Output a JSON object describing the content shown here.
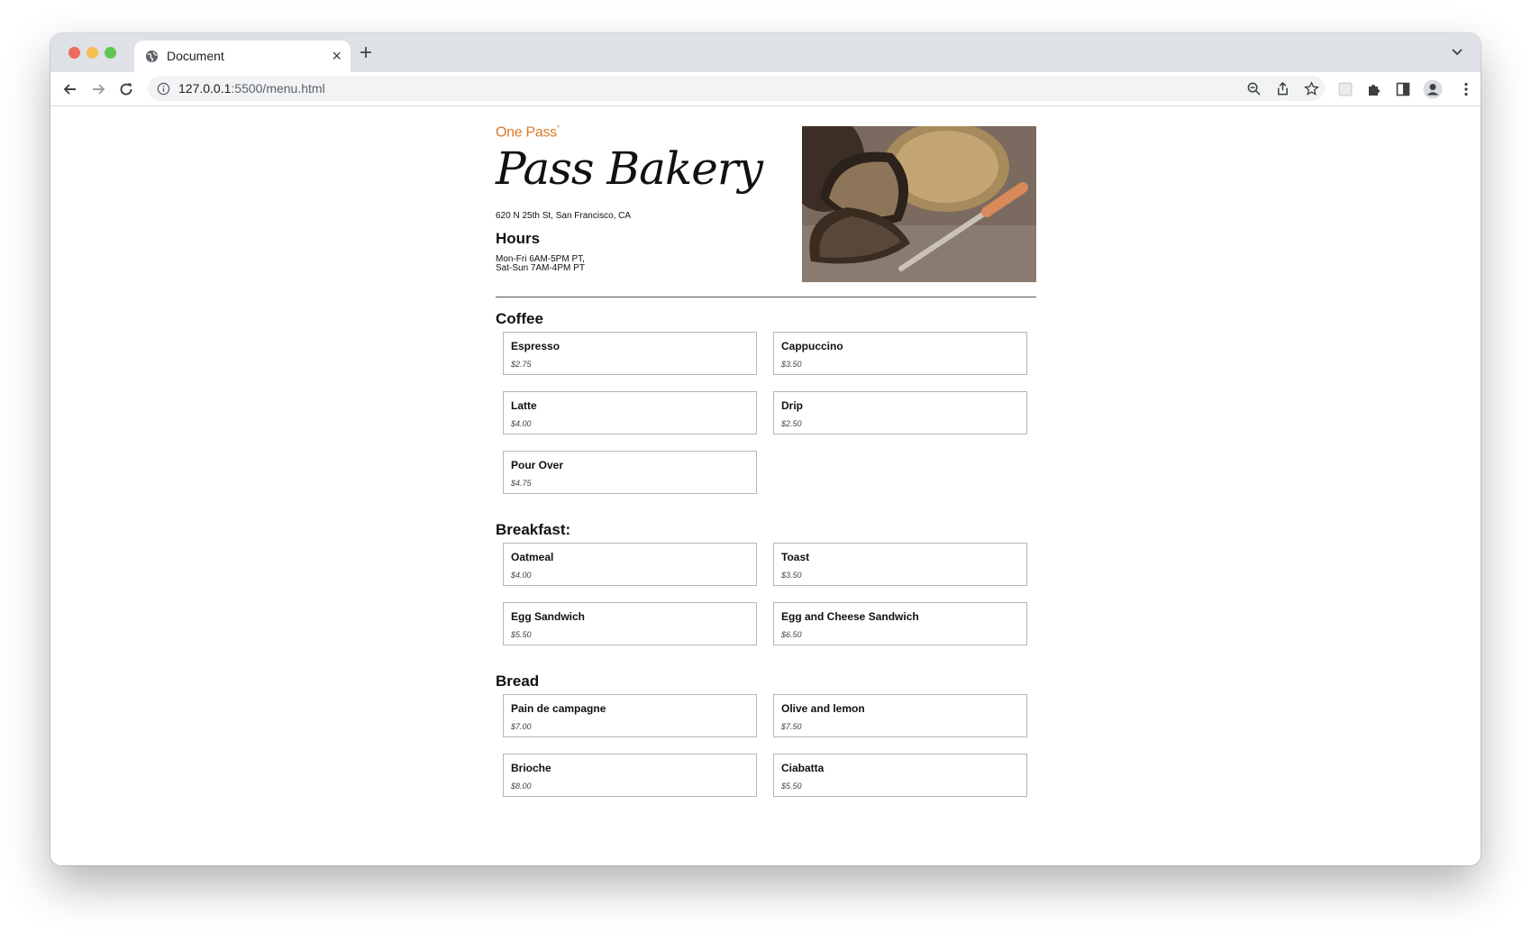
{
  "browser": {
    "tab_title": "Document",
    "close_glyph": "×",
    "new_tab_glyph": "+",
    "url_host": "127.0.0.1",
    "url_rest": ":5500/menu.html"
  },
  "header": {
    "brand": "One Pass",
    "brand_mark": "°",
    "title": "Pass Bakery",
    "address": "620 N 25th St, San Francisco, CA",
    "hours_title": "Hours",
    "hours_lines": [
      "Mon-Fri 6AM-5PM PT,",
      "Sat-Sun 7AM-4PM PT"
    ]
  },
  "sections": [
    {
      "title": "Coffee",
      "items": [
        {
          "name": "Espresso",
          "price": "$2.75"
        },
        {
          "name": "Cappuccino",
          "price": "$3.50"
        },
        {
          "name": "Latte",
          "price": "$4.00"
        },
        {
          "name": "Drip",
          "price": "$2.50"
        },
        {
          "name": "Pour Over",
          "price": "$4.75"
        }
      ]
    },
    {
      "title": "Breakfast:",
      "items": [
        {
          "name": "Oatmeal",
          "price": "$4.00"
        },
        {
          "name": "Toast",
          "price": "$3.50"
        },
        {
          "name": "Egg Sandwich",
          "price": "$5.50"
        },
        {
          "name": "Egg and Cheese Sandwich",
          "price": "$6.50"
        }
      ]
    },
    {
      "title": "Bread",
      "items": [
        {
          "name": "Pain de campagne",
          "price": "$7.00"
        },
        {
          "name": "Olive and lemon",
          "price": "$7.50"
        },
        {
          "name": "Brioche",
          "price": "$8.00"
        },
        {
          "name": "Ciabatta",
          "price": "$5.50"
        }
      ]
    }
  ]
}
